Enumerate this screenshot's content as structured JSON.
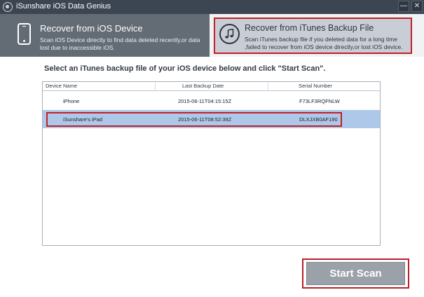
{
  "window": {
    "title": "iSunshare iOS Data Genius",
    "controls": {
      "minimize": "—",
      "close": "✕"
    }
  },
  "modes": {
    "ios_device": {
      "title": "Recover from iOS Device",
      "description": "Scan iOS Device directly to find data deleted recently,or data lost due to inaccessible iOS.",
      "icon": "phone-icon",
      "selected": false
    },
    "itunes_backup": {
      "title": "Recover from iTunes Backup File",
      "description": "Scan iTunes backup file if you deleted data for a long time ,failed to recover from iOS device directly,or lost iOS device.",
      "icon": "music-note-icon",
      "selected": true
    }
  },
  "instruction": "Select an iTunes backup file of your iOS device below and click \"Start Scan\".",
  "backup_table": {
    "columns": [
      "Device Name",
      "Last Backup Date",
      "Serial Number"
    ],
    "rows": [
      {
        "device": "iPhone",
        "date": "2015-06-11T04:15:15Z",
        "serial": "F73LF3RQFNLW",
        "selected": false
      },
      {
        "device": "iSunshare's iPad",
        "date": "2015-06-11T08:52:39Z",
        "serial": "DLXJXB0AF190",
        "selected": true
      }
    ]
  },
  "start_scan_label": "Start Scan",
  "colors": {
    "titlebar": "#3c4652",
    "active_card": "#636b75",
    "selected_card": "#c9ced6",
    "highlight_border": "#c21f26",
    "selected_row": "#aec8e9",
    "button": "#9aa1a9"
  }
}
